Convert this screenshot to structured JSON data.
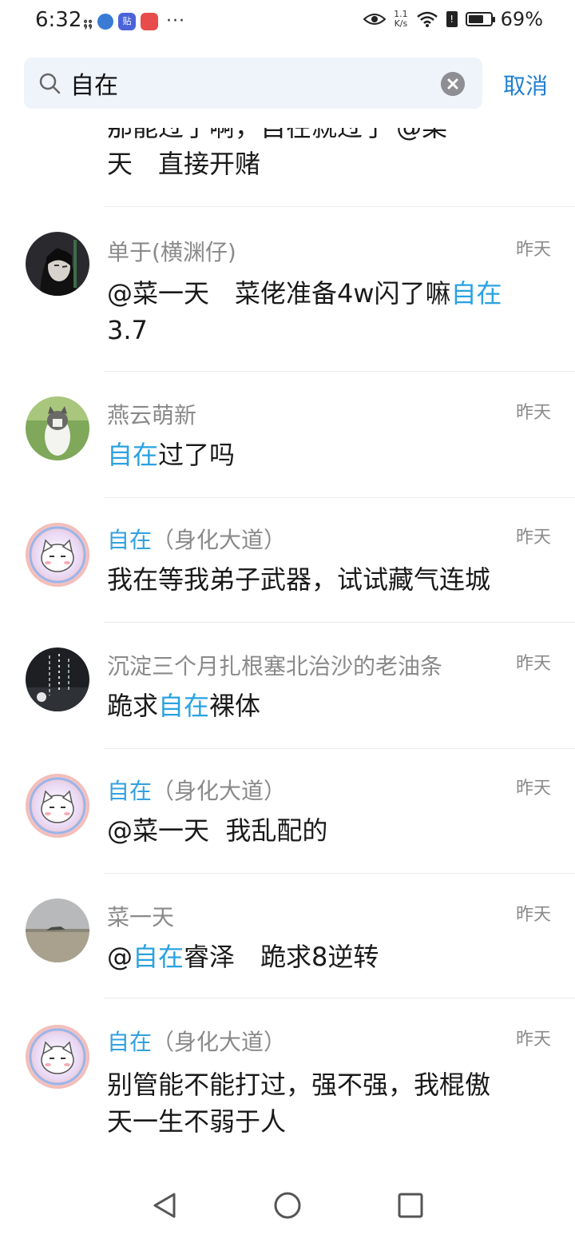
{
  "status_bar": {
    "time": "6:32",
    "signal_glyphs": "⨟⨟",
    "app_badge": "贴",
    "more": "···",
    "net_speed_value": "1.1",
    "net_speed_unit": "K/s",
    "sim_label": "!",
    "battery_percent": "69%",
    "battery_level": 0.69
  },
  "search": {
    "query": "自在",
    "cancel_label": "取消"
  },
  "colors": {
    "highlight": "#2aa2e0",
    "cancel": "#1f7fd0"
  },
  "partial_item": {
    "line1": "那能过了啊，自在就过了 @菜",
    "line2": "天　直接开赌"
  },
  "messages": [
    {
      "name": "单于(横渊仔)",
      "time": "昨天",
      "pre": "@菜一天　菜佬准备4w闪了嘛",
      "hl": "自在",
      "post": "",
      "line2": "3.7",
      "avatar": "dark-anime-avatar"
    },
    {
      "name": "燕云萌新",
      "time": "昨天",
      "pre": "",
      "hl": "自在",
      "post": "过了吗",
      "line2": "",
      "avatar": "cat-photo-avatar"
    },
    {
      "name_hl": "自在",
      "name_rest": "（身化大道）",
      "time": "昨天",
      "text": "我在等我弟子武器，试试藏气连城",
      "avatar": "cartoon-cat-avatar"
    },
    {
      "name": "沉淀三个月扎根塞北治沙的老油条",
      "time": "昨天",
      "pre": "跪求",
      "hl": "自在",
      "post": "裸体",
      "line2": "",
      "avatar": "dark-calligraphy-avatar"
    },
    {
      "name_hl": "自在",
      "name_rest": "（身化大道）",
      "time": "昨天",
      "text": "@菜一天  我乱配的",
      "avatar": "cartoon-cat-avatar"
    },
    {
      "name": "菜一天",
      "time": "昨天",
      "pre": "@",
      "hl": "自在",
      "post": "睿泽　跪求8逆转",
      "line2": "",
      "avatar": "seascape-avatar"
    },
    {
      "name_hl": "自在",
      "name_rest": "（身化大道）",
      "time": "昨天",
      "text": "别管能不能打过，强不强，我棍傲",
      "line2": "天一生不弱于人",
      "avatar": "cartoon-cat-avatar"
    }
  ],
  "nav": {
    "back": "back-icon",
    "home": "home-icon",
    "recents": "recents-icon"
  }
}
